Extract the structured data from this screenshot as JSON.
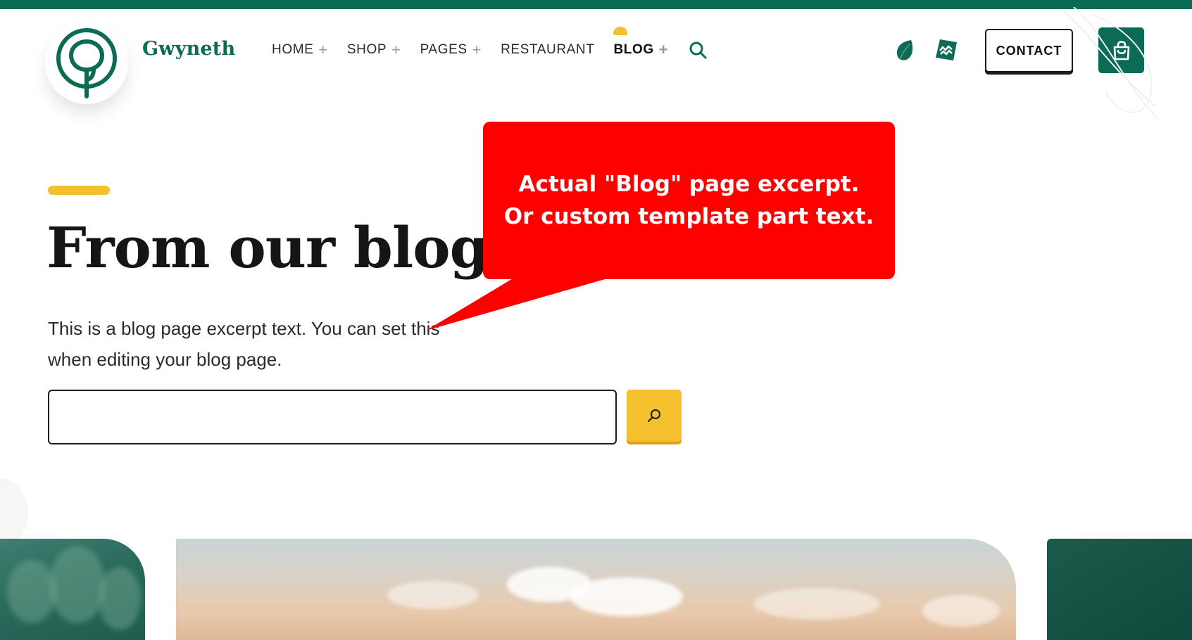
{
  "brand": {
    "name": "Gwyneth"
  },
  "nav": {
    "items": [
      {
        "label": "HOME",
        "has_submenu": true,
        "active": false
      },
      {
        "label": "SHOP",
        "has_submenu": true,
        "active": false
      },
      {
        "label": "PAGES",
        "has_submenu": true,
        "active": false
      },
      {
        "label": "RESTAURANT",
        "has_submenu": false,
        "active": false
      },
      {
        "label": "BLOG",
        "has_submenu": true,
        "active": true
      }
    ],
    "plus_symbol": "+",
    "search_icon": "search-icon"
  },
  "header_actions": {
    "social_icons": [
      "leaf-icon",
      "wave-badge-icon"
    ],
    "contact_label": "CONTACT",
    "cart_icon": "shopping-bag-icon"
  },
  "hero": {
    "title": "From our blog",
    "excerpt": "This is a blog page excerpt text. You can set this when editing your blog page.",
    "search_value": "",
    "search_button_icon": "search-icon"
  },
  "callout": {
    "line1": "Actual \"Blog\" page excerpt.",
    "line2": "Or custom template part text."
  },
  "colors": {
    "brand_green": "#0c6b55",
    "accent_yellow": "#f5c02e",
    "callout_red": "#fe0000"
  }
}
